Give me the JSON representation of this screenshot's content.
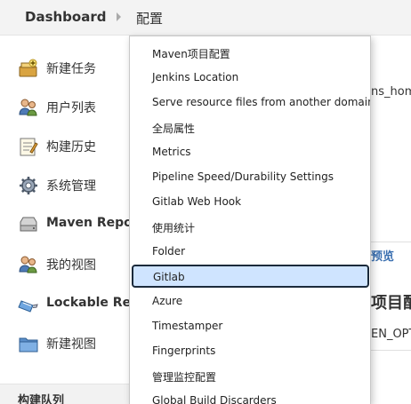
{
  "breadcrumb": {
    "root": "Dashboard",
    "current": "配置"
  },
  "sidebar": {
    "items": [
      {
        "label": "新建任务",
        "icon": "new-job-icon"
      },
      {
        "label": "用户列表",
        "icon": "users-icon"
      },
      {
        "label": "构建历史",
        "icon": "build-history-icon"
      },
      {
        "label": "系统管理",
        "icon": "gear-icon"
      },
      {
        "label": "Maven Repositories",
        "icon": "maven-repo-icon"
      },
      {
        "label": "我的视图",
        "icon": "my-views-icon"
      },
      {
        "label": "Lockable Resources",
        "icon": "lockable-resources-icon"
      },
      {
        "label": "新建视图",
        "icon": "folder-icon"
      }
    ],
    "build_queue_label": "构建队列"
  },
  "background": {
    "env_text": "ns_hom",
    "preview_link": "预览",
    "section_heading": "项目配",
    "env_var": "EN_OPT"
  },
  "dropdown": {
    "items": [
      "Maven项目配置",
      "Jenkins Location",
      "Serve resource files from another domain",
      "全局属性",
      "Metrics",
      "Pipeline Speed/Durability Settings",
      "Gitlab Web Hook",
      "使用统计",
      "Folder",
      "Gitlab",
      "Azure",
      "Timestamper",
      "Fingerprints",
      "管理监控配置",
      "Global Build Discarders"
    ],
    "selected_index": 9
  }
}
